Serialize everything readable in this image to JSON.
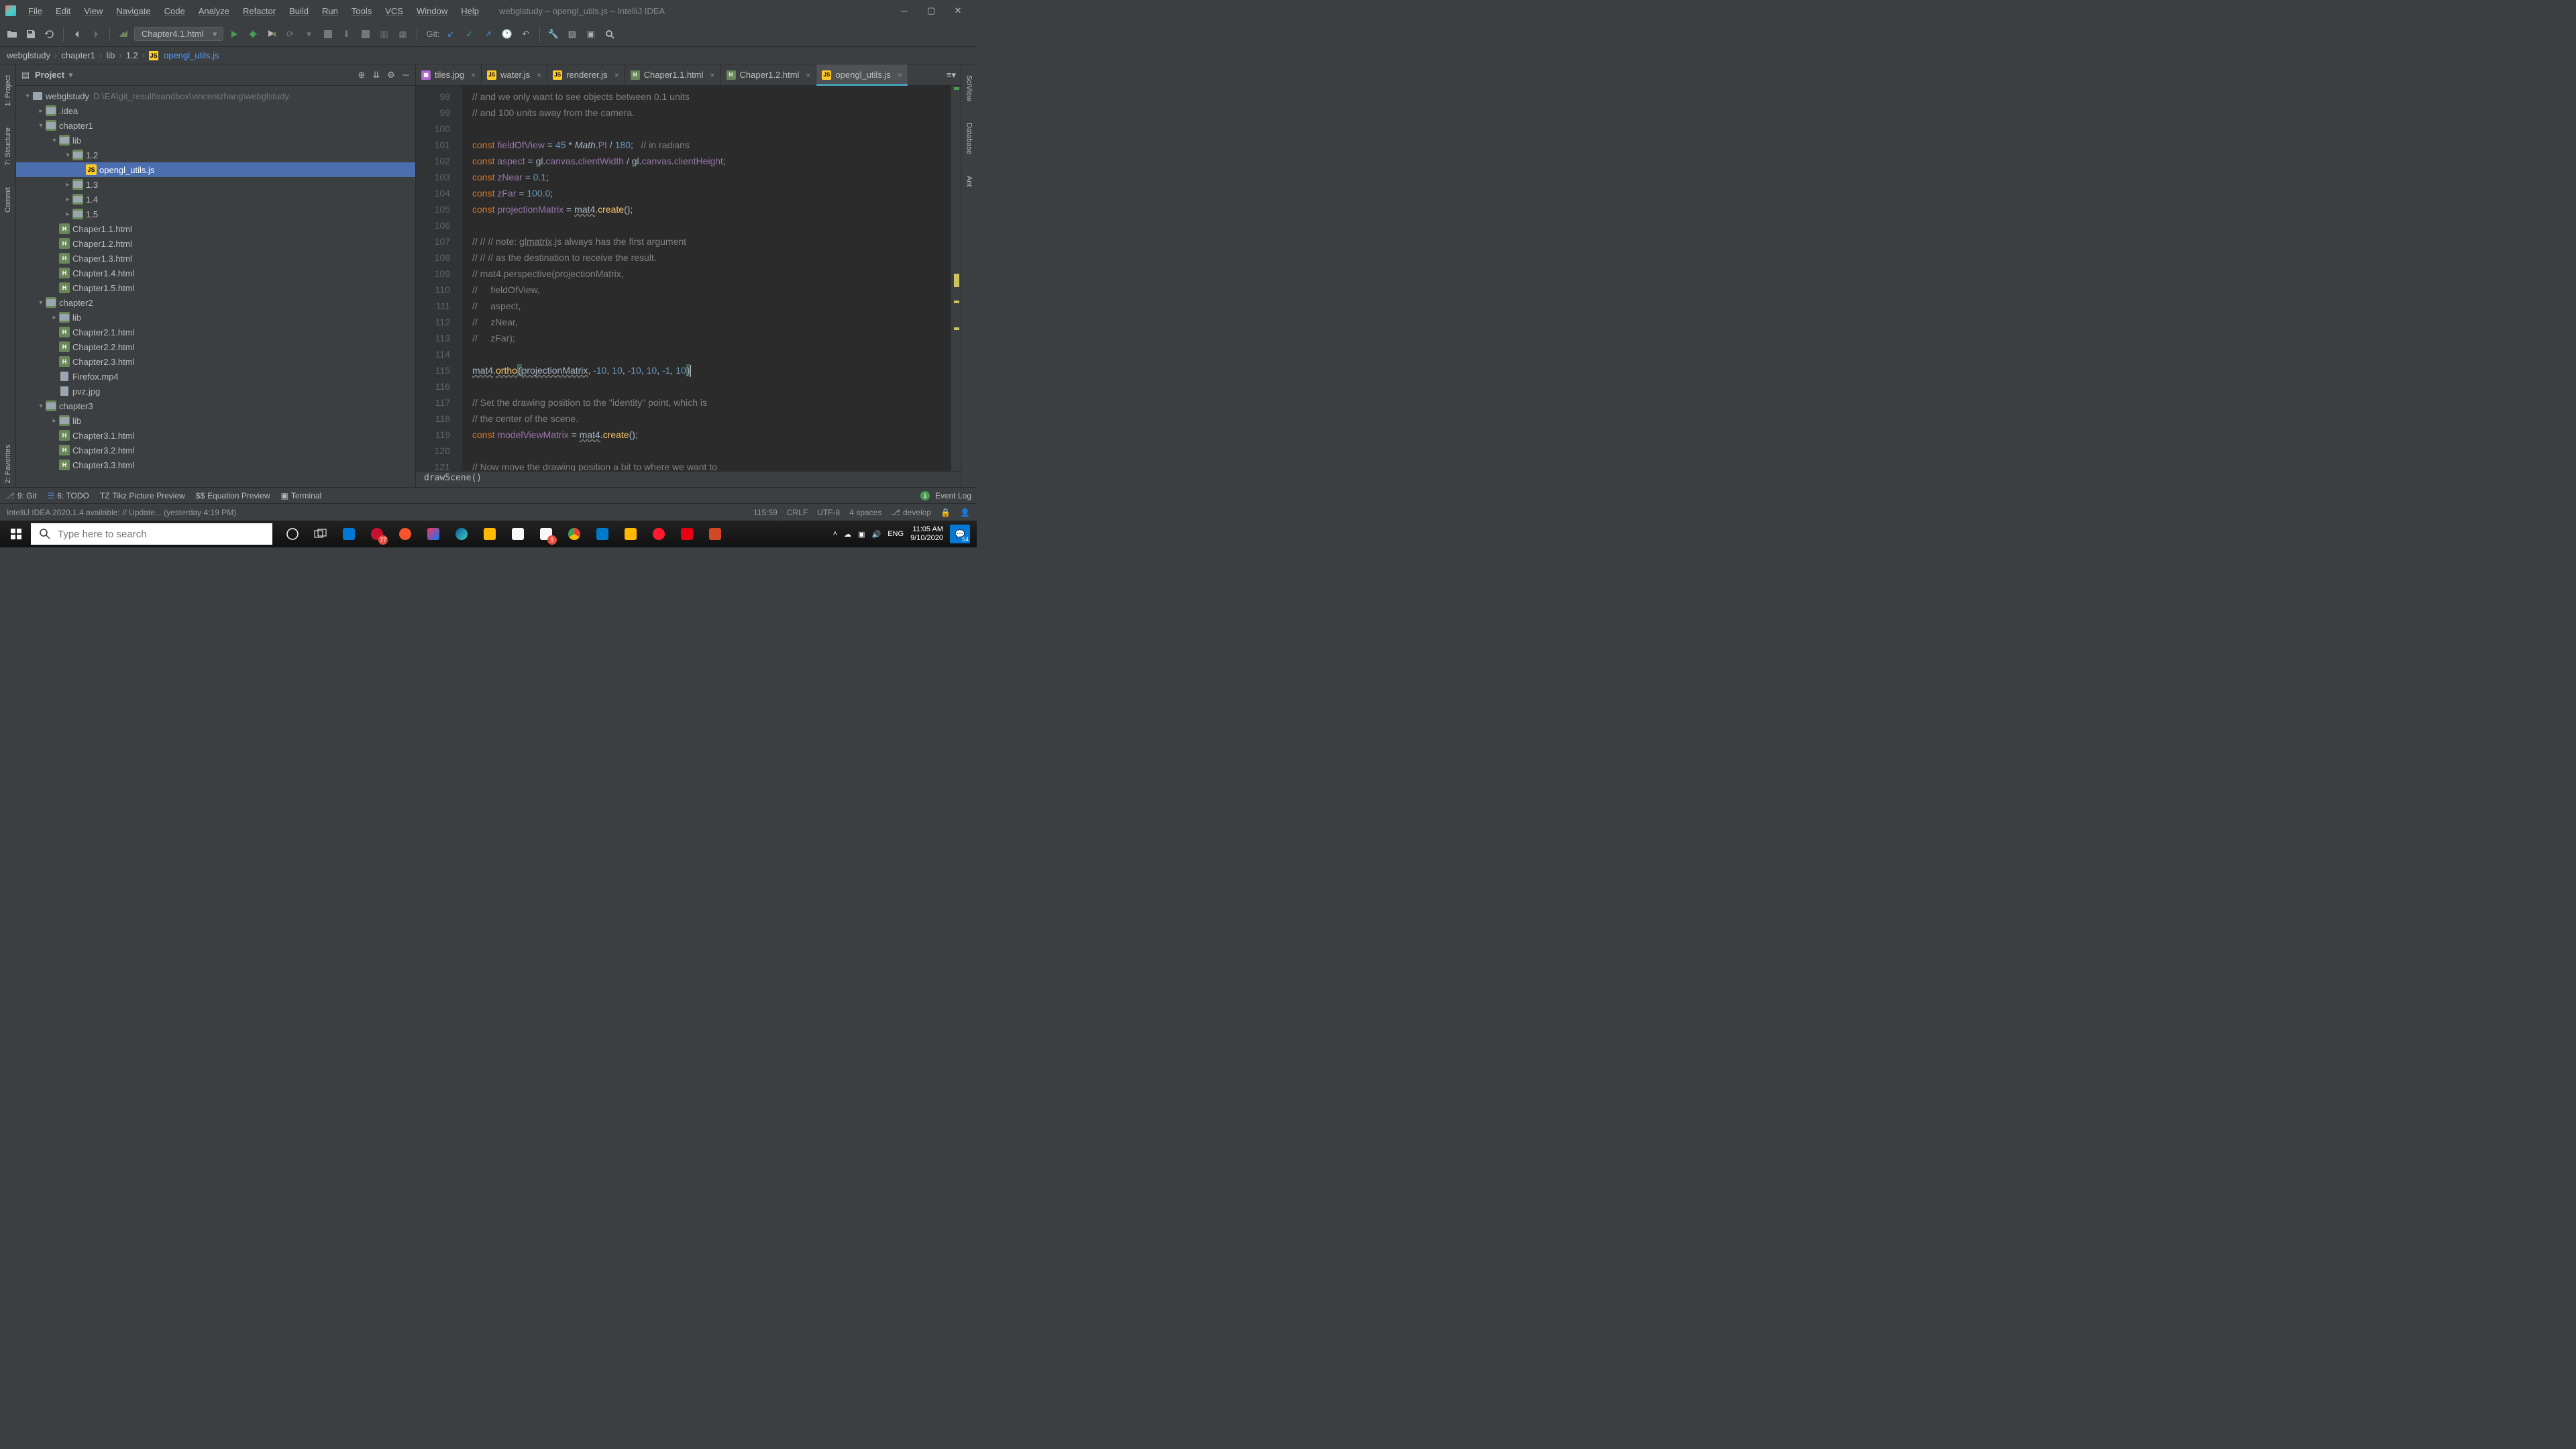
{
  "window": {
    "title": "webglstudy – opengl_utils.js – IntelliJ IDEA"
  },
  "menu": [
    "File",
    "Edit",
    "View",
    "Navigate",
    "Code",
    "Analyze",
    "Refactor",
    "Build",
    "Run",
    "Tools",
    "VCS",
    "Window",
    "Help"
  ],
  "run_config": "Chapter4.1.html",
  "git_label": "Git:",
  "breadcrumbs": [
    "webglstudy",
    "chapter1",
    "lib",
    "1.2",
    "opengl_utils.js"
  ],
  "project_panel": {
    "label": "Project"
  },
  "left_tabs": [
    "1: Project",
    "7: Structure",
    "Commit",
    "2: Favorites"
  ],
  "right_tabs": [
    "SciView",
    "Database",
    "Ant"
  ],
  "tree": [
    {
      "depth": 0,
      "arrow": "▾",
      "icon": "project",
      "text": "webglstudy",
      "path": "D:\\EA\\git_result\\sandbox\\vincentzhang\\webglstudy"
    },
    {
      "depth": 1,
      "arrow": "▸",
      "icon": "folder",
      "text": ".idea"
    },
    {
      "depth": 1,
      "arrow": "▾",
      "icon": "folder",
      "text": "chapter1"
    },
    {
      "depth": 2,
      "arrow": "▾",
      "icon": "folder",
      "text": "lib"
    },
    {
      "depth": 3,
      "arrow": "▾",
      "icon": "folder",
      "text": "1.2"
    },
    {
      "depth": 4,
      "arrow": "",
      "icon": "js",
      "text": "opengl_utils.js",
      "selected": true
    },
    {
      "depth": 3,
      "arrow": "▸",
      "icon": "folder",
      "text": "1.3"
    },
    {
      "depth": 3,
      "arrow": "▸",
      "icon": "folder",
      "text": "1.4"
    },
    {
      "depth": 3,
      "arrow": "▸",
      "icon": "folder",
      "text": "1.5"
    },
    {
      "depth": 2,
      "arrow": "",
      "icon": "html",
      "text": "Chaper1.1.html"
    },
    {
      "depth": 2,
      "arrow": "",
      "icon": "html",
      "text": "Chaper1.2.html"
    },
    {
      "depth": 2,
      "arrow": "",
      "icon": "html",
      "text": "Chaper1.3.html"
    },
    {
      "depth": 2,
      "arrow": "",
      "icon": "html",
      "text": "Chapter1.4.html"
    },
    {
      "depth": 2,
      "arrow": "",
      "icon": "html",
      "text": "Chapter1.5.html"
    },
    {
      "depth": 1,
      "arrow": "▾",
      "icon": "folder",
      "text": "chapter2"
    },
    {
      "depth": 2,
      "arrow": "▸",
      "icon": "folder",
      "text": "lib"
    },
    {
      "depth": 2,
      "arrow": "",
      "icon": "html",
      "text": "Chapter2.1.html"
    },
    {
      "depth": 2,
      "arrow": "",
      "icon": "html",
      "text": "Chapter2.2.html"
    },
    {
      "depth": 2,
      "arrow": "",
      "icon": "html",
      "text": "Chapter2.3.html"
    },
    {
      "depth": 2,
      "arrow": "",
      "icon": "file",
      "text": "Firefox.mp4"
    },
    {
      "depth": 2,
      "arrow": "",
      "icon": "file",
      "text": "pvz.jpg"
    },
    {
      "depth": 1,
      "arrow": "▾",
      "icon": "folder",
      "text": "chapter3"
    },
    {
      "depth": 2,
      "arrow": "▸",
      "icon": "folder",
      "text": "lib"
    },
    {
      "depth": 2,
      "arrow": "",
      "icon": "html",
      "text": "Chapter3.1.html"
    },
    {
      "depth": 2,
      "arrow": "",
      "icon": "html",
      "text": "Chapter3.2.html"
    },
    {
      "depth": 2,
      "arrow": "",
      "icon": "html",
      "text": "Chapter3.3.html"
    }
  ],
  "editor_tabs": [
    {
      "icon": "img",
      "label": "tiles.jpg"
    },
    {
      "icon": "js",
      "label": "water.js"
    },
    {
      "icon": "js",
      "label": "renderer.js"
    },
    {
      "icon": "html",
      "label": "Chaper1.1.html"
    },
    {
      "icon": "html",
      "label": "Chaper1.2.html"
    },
    {
      "icon": "js",
      "label": "opengl_utils.js",
      "active": true
    }
  ],
  "gutter_lines": [
    "98",
    "99",
    "100",
    "101",
    "102",
    "103",
    "104",
    "105",
    "106",
    "107",
    "108",
    "109",
    "110",
    "111",
    "112",
    "113",
    "114",
    "115",
    "116",
    "117",
    "118",
    "119",
    "120",
    "121"
  ],
  "editor_breadcrumb": "drawScene()",
  "bottom_tools": {
    "git": "9: Git",
    "todo": "6: TODO",
    "tikz": "Tikz Picture Preview",
    "eq": "Equation Preview",
    "term": "Terminal",
    "event_count": "1",
    "event_log": "Event Log"
  },
  "status": {
    "msg": "IntelliJ IDEA 2020.1.4 available: // Update... (yesterday 4:19 PM)",
    "pos": "115:59",
    "sep": "CRLF",
    "enc": "UTF-8",
    "indent": "4 spaces",
    "branch": "develop"
  },
  "taskbar": {
    "search_placeholder": "Type here to search",
    "lang": "ENG",
    "time": "11:05 AM",
    "date": "9/10/2020",
    "notif_count": "54",
    "mail_badge": "5",
    "mc_badge": "77"
  }
}
